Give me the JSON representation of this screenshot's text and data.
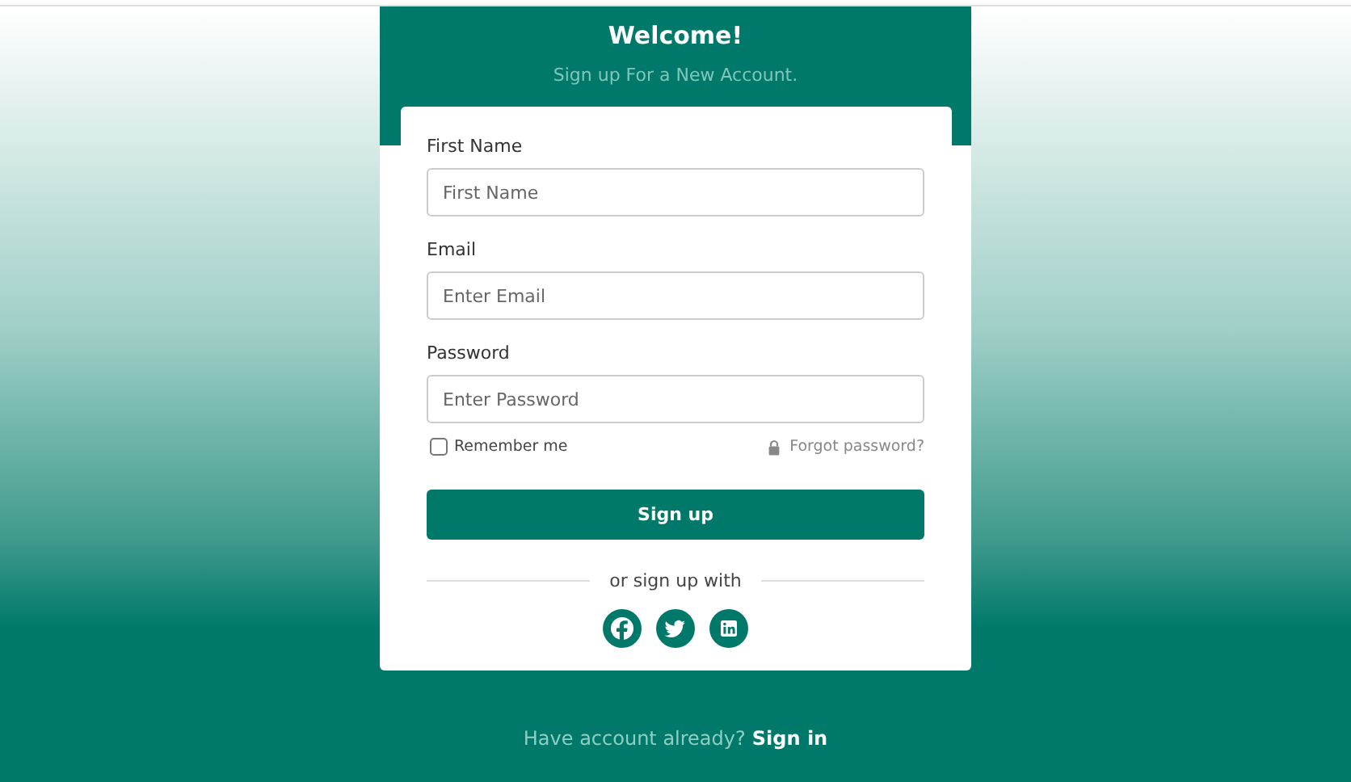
{
  "header": {
    "title": "Welcome!",
    "subtitle": "Sign up For a New Account."
  },
  "fields": [
    {
      "label": "First Name",
      "placeholder": "First Name"
    },
    {
      "label": "Email",
      "placeholder": "Enter Email"
    },
    {
      "label": "Password",
      "placeholder": "Enter Password"
    }
  ],
  "remember": {
    "label": "Remember me",
    "checked": false
  },
  "forgot": {
    "label": "Forgot password?"
  },
  "submit": {
    "label": "Sign up"
  },
  "divider": {
    "label": "or sign up with"
  },
  "social": [
    {
      "kind": "facebook"
    },
    {
      "kind": "twitter"
    },
    {
      "kind": "linkedin"
    }
  ],
  "footer": {
    "text": "Have account already?",
    "link": "Sign in"
  }
}
